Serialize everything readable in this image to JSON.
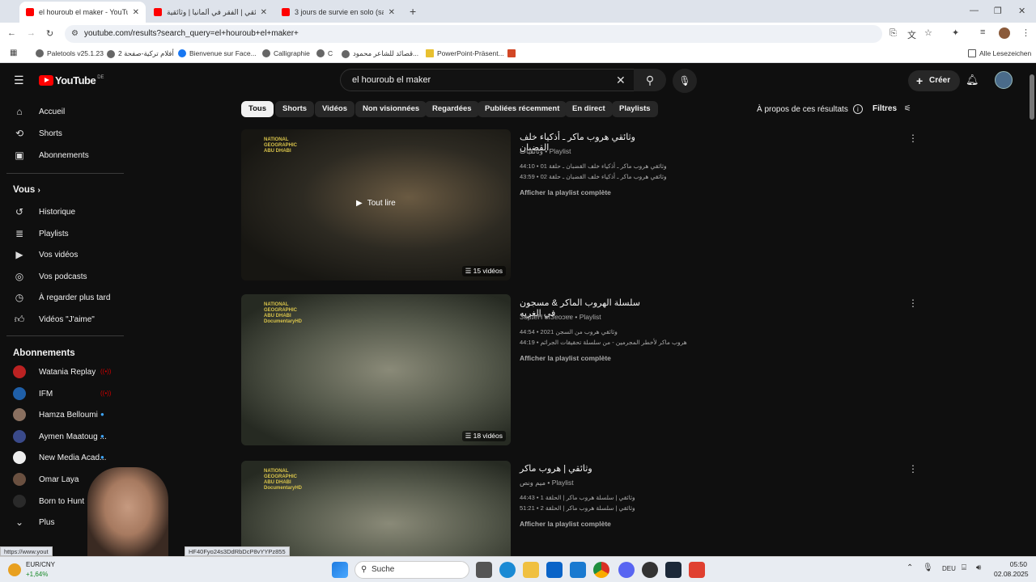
{
  "browser": {
    "tabs": [
      {
        "title": "el houroub el maker - YouTube",
        "active": true
      },
      {
        "title": "وثائقي | الفقر في ألمانيا | وثائقية",
        "active": false
      },
      {
        "title": "3 jours de survie en solo (sans",
        "active": false
      }
    ],
    "new_tab": "+",
    "url": "youtube.com/results?search_query=el+houroub+el+maker+",
    "bookmarks": [
      "Paletools v25.1.23",
      "أفلام تركية-صفحة 2",
      "Bienvenue sur Face...",
      "Calligraphie",
      "C",
      "قصائد للشاعر محمود...",
      "PowerPoint-Präsent...",
      "Alle Lesezeichen"
    ],
    "status_url": "https://www.yout",
    "status_url_tail": "HF40Fyo24s3DdRbDcP8vYYPz855"
  },
  "yt": {
    "logo": "YouTube",
    "region": "DE",
    "search_value": "el houroub el maker",
    "create_label": "Créer",
    "sidebar": {
      "main": [
        "Accueil",
        "Shorts",
        "Abonnements"
      ],
      "you_title": "Vous",
      "you_items": [
        "Historique",
        "Playlists",
        "Vos vidéos",
        "Vos podcasts",
        "À regarder plus tard",
        "Vidéos \"J'aime\""
      ],
      "subs_title": "Abonnements",
      "subs": [
        "Watania Replay",
        "IFM",
        "Hamza Belloumi",
        "Aymen Maatoug ...",
        "New Media Acad...",
        "Omar Laya",
        "Born to Hunt",
        "Plus"
      ]
    },
    "chips": [
      "Tous",
      "Shorts",
      "Vidéos",
      "Non visionnées",
      "Regardées",
      "Publiées récemment",
      "En direct",
      "Playlists"
    ],
    "about_results": "À propos de ces résultats",
    "filters": "Filtres",
    "play_all": "Tout lire",
    "results": [
      {
        "title": "وثائقي هروب ماكر ـ أذكياء خلف القضبان",
        "meta": "وثائقيات • Playlist",
        "lines": [
          "44:10 • وثائقي هروب ماكر ـ أذكياء خلف القضبان ـ حلقة 01",
          "43:59 • وثائقي هروب ماكر ـ أذكياء خلف القضبان ـ حلقة 02"
        ],
        "link": "Afficher la playlist complète",
        "count": "15 vidéos"
      },
      {
        "title": "سلسلة الهروب الماكر & مسجون في الغربه",
        "meta": "ЗɐpɹɐН ɐıЗɐoɔɐɐ • Playlist",
        "lines": [
          "44:54 • 2021 وثائقي هروب من السجن",
          "44:19 • هروب ماكر لأخطر المجرمين - من سلسلة تحقيقات الجرائم"
        ],
        "link": "Afficher la playlist complète",
        "count": "18 vidéos"
      },
      {
        "title": "وثائقي | هروب ماكر",
        "meta": "ميم ونص • Playlist",
        "lines": [
          "44:43 • وثائقي | سلسلة هروب ماكر | الحلقة 1",
          "51:21 • وثائقي | سلسلة هروب ماكر | الحلقة 2"
        ],
        "link": "Afficher la playlist complète",
        "count": ""
      }
    ],
    "thumb_brand": [
      "NATIONAL",
      "GEOGRAPHIC",
      "ABU DHABI"
    ],
    "thumb_brand2": "DocumentaryHD"
  },
  "taskbar": {
    "ticker_name": "EUR/CNY",
    "ticker_change": "+1,64%",
    "search": "Suche",
    "lang": "DEU",
    "time": "05:50",
    "date": "02.08.2025"
  },
  "colors": {
    "yt_red": "#ff0000",
    "bg": "#0f0f0f",
    "chip_bg": "#272727",
    "live_blue": "#3ea6ff"
  }
}
